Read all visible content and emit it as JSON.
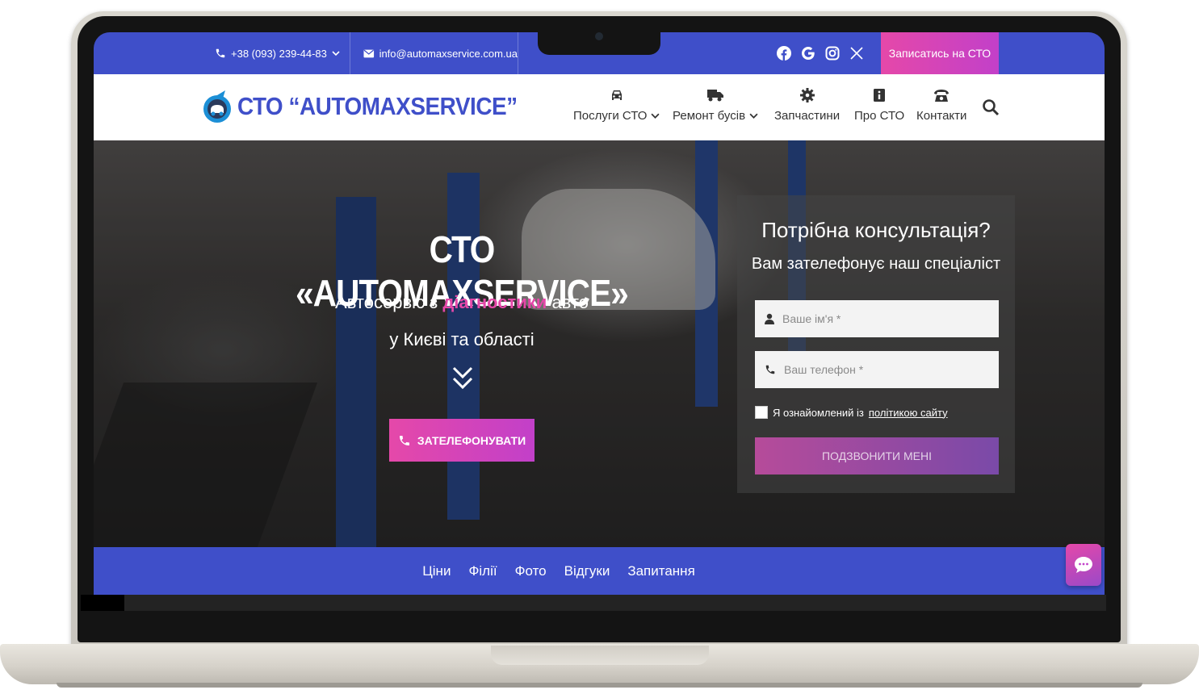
{
  "topbar": {
    "phone": "+38 (093) 239-44-83",
    "email": "info@automaxservice.com.ua",
    "socials": [
      "facebook-icon",
      "google-icon",
      "instagram-icon",
      "x-icon"
    ],
    "cta": "Записатись на СТО"
  },
  "header": {
    "logo_text": "СТО “AUTOMAXSERVICE”",
    "nav": [
      {
        "label": "Послуги СТО",
        "icon": "car-icon",
        "dropdown": true
      },
      {
        "label": "Ремонт бусів",
        "icon": "truck-icon",
        "dropdown": true
      },
      {
        "label": "Запчастини",
        "icon": "gear-icon",
        "dropdown": false
      },
      {
        "label": "Про СТО",
        "icon": "info-icon",
        "dropdown": false
      },
      {
        "label": "Контакти",
        "icon": "phone-icon",
        "dropdown": false
      }
    ]
  },
  "hero": {
    "title": "СТО «AUTOMAXSERVICE»",
    "sub_before": "Автосервіс з ",
    "sub_highlight": "діагностики",
    "sub_after": " авто",
    "sub_line2": "у Києві та області",
    "call_button": "ЗАТЕЛЕФОНУВАТИ"
  },
  "form": {
    "title": "Потрібна консультація?",
    "subtitle": "Вам зателефонує наш спеціаліст",
    "name_placeholder": "Ваше ім'я *",
    "phone_placeholder": "Ваш телефон *",
    "agree_text": "Я ознайомлений із ",
    "agree_link": "політикою сайту",
    "submit": "ПОДЗВОНИТИ МЕНІ"
  },
  "bottom_nav": [
    "Ціни",
    "Філії",
    "Фото",
    "Відгуки",
    "Запитання"
  ],
  "colors": {
    "brand_blue": "#3f4fc9",
    "accent_pink": "#e548a9",
    "accent_purple": "#c240c9"
  }
}
